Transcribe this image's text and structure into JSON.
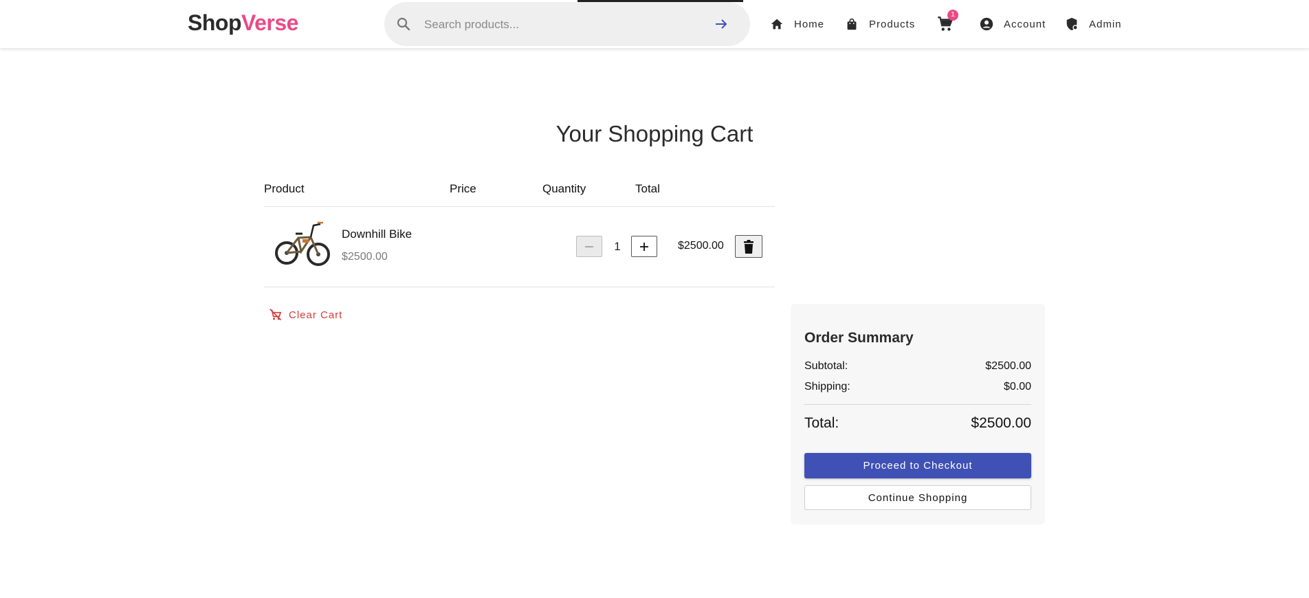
{
  "header": {
    "logo_part1": "Shop",
    "logo_part2": "Verse",
    "search": {
      "placeholder": "Search products..."
    },
    "nav": {
      "home": "Home",
      "products": "Products",
      "account": "Account",
      "admin": "Admin"
    },
    "cart_badge": "1"
  },
  "cart": {
    "title": "Your Shopping Cart",
    "columns": [
      "Product",
      "Price",
      "Quantity",
      "Total"
    ],
    "items": [
      {
        "name": "Downhill Bike",
        "price": "$2500.00",
        "quantity": "1",
        "total": "$2500.00"
      }
    ],
    "clear_label": "Clear Cart"
  },
  "summary": {
    "title": "Order Summary",
    "subtotal_label": "Subtotal:",
    "subtotal_value": "$2500.00",
    "shipping_label": "Shipping:",
    "shipping_value": "$0.00",
    "total_label": "Total:",
    "total_value": "$2500.00",
    "checkout_label": "Proceed to Checkout",
    "continue_label": "Continue Shopping"
  },
  "colors": {
    "brand_dark": "#2b2b2b",
    "brand_accent": "#e94b86",
    "primary": "#3f51b5",
    "danger": "#d33b3b"
  },
  "icons": [
    "search-icon",
    "arrow-right-icon",
    "home-icon",
    "shopping-bag-icon",
    "cart-icon",
    "account-circle-icon",
    "admin-shield-icon",
    "minus-icon",
    "plus-icon",
    "trash-icon",
    "remove-cart-icon"
  ]
}
